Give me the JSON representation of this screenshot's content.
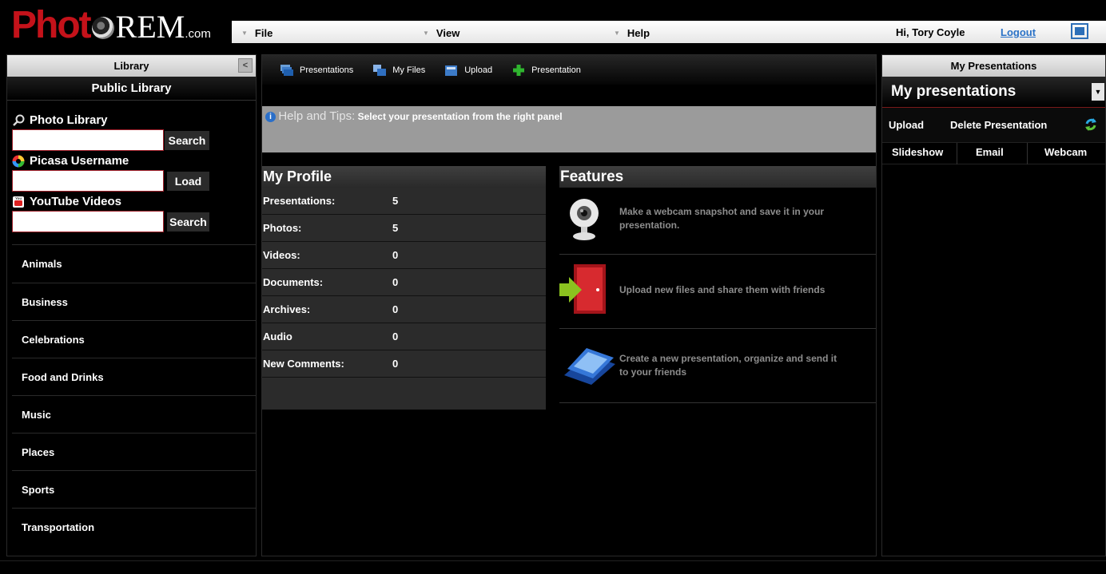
{
  "logo": {
    "part1": "Phot",
    "part2": "REM",
    "part3": ".com"
  },
  "menu": {
    "file": "File",
    "view": "View",
    "help": "Help"
  },
  "user": {
    "greeting": "Hi, Tory Coyle",
    "logout": "Logout"
  },
  "library": {
    "header": "Library",
    "public_title": "Public Library",
    "photo_label": "Photo Library",
    "photo_button": "Search",
    "picasa_label": "Picasa Username",
    "picasa_button": "Load",
    "youtube_label": "YouTube Videos",
    "youtube_button": "Search",
    "categories": [
      "Animals",
      "Business",
      "Celebrations",
      "Food and Drinks",
      "Music",
      "Places",
      "Sports",
      "Transportation"
    ]
  },
  "toolbar": {
    "presentations": "Presentations",
    "my_files": "My Files",
    "upload": "Upload",
    "new_presentation": "Presentation"
  },
  "help": {
    "tag": "Help and Tips:",
    "message": "Select your presentation from the right panel"
  },
  "profile": {
    "title": "My Profile",
    "rows": [
      {
        "label": "Presentations:",
        "value": "5"
      },
      {
        "label": "Photos:",
        "value": "5"
      },
      {
        "label": "Videos:",
        "value": "0"
      },
      {
        "label": "Documents:",
        "value": "0"
      },
      {
        "label": "Archives:",
        "value": "0"
      },
      {
        "label": "Audio",
        "value": "0"
      },
      {
        "label": "New Comments:",
        "value": "0"
      }
    ]
  },
  "features": {
    "title": "Features",
    "items": [
      {
        "line1": "Make a webcam snapshot and save it in your",
        "line2": "presentation.",
        "icon": "webcam-icon"
      },
      {
        "line1": "Upload new files and share them with friends",
        "line2": "",
        "icon": "upload-door-icon"
      },
      {
        "line1": "Create a new presentation, organize and send it",
        "line2": "to your friends",
        "icon": "presentation-folder-icon"
      }
    ]
  },
  "right_panel": {
    "header": "My Presentations",
    "title": "My presentations",
    "upload": "Upload",
    "delete": "Delete Presentation",
    "slideshow": "Slideshow",
    "email": "Email",
    "webcam": "Webcam"
  },
  "colors": {
    "logo_red": "#c4121a",
    "logout_link": "#2a72c7",
    "input_border": "#a0202a",
    "help_bg": "#9b9b9b"
  }
}
